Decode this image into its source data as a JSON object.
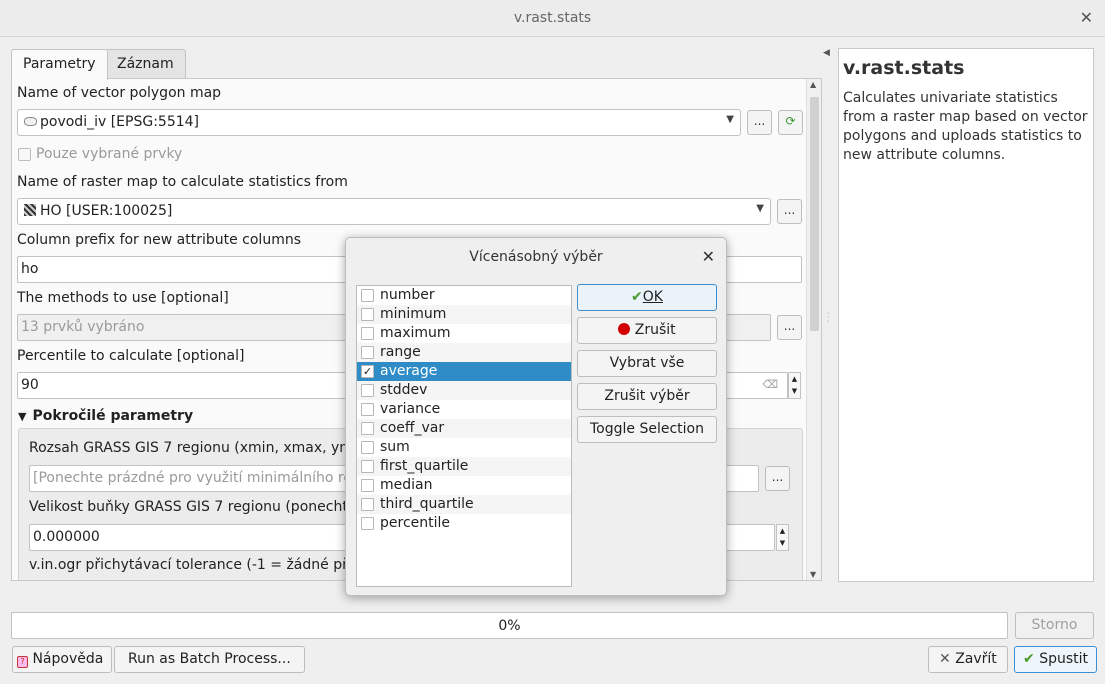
{
  "window": {
    "title": "v.rast.stats"
  },
  "tabs": [
    "Parametry",
    "Záznam"
  ],
  "form": {
    "vector_label": "Name of vector polygon map",
    "vector_value": "povodi_iv [EPSG:5514]",
    "only_selected_label": "Pouze vybrané prvky",
    "raster_label": "Name of raster map to calculate statistics from",
    "raster_value": "HO [USER:100025]",
    "prefix_label": "Column prefix for new attribute columns",
    "prefix_value": "ho",
    "methods_label": "The methods to use [optional]",
    "methods_value": "13 prvků vybráno",
    "percentile_label": "Percentile to calculate [optional]",
    "percentile_value": "90",
    "advanced_label": "Pokročilé parametry",
    "region_label": "Rozsah GRASS GIS 7 regionu (xmin, xmax, ymin",
    "region_placeholder": "[Ponechte prázdné pro využití minimálního rozs",
    "cellsize_label": "Velikost buňky GRASS GIS 7 regionu (ponechte",
    "cellsize_value": "0.000000",
    "snap_label": "v.in.ogr přichytávací tolerance (-1 = žádné přichy",
    "dots": "..."
  },
  "help": {
    "title": "v.rast.stats",
    "description": "Calculates univariate statistics from a raster map based on vector polygons and uploads statistics to new attribute columns."
  },
  "progress": {
    "percent": 0,
    "text": "0%"
  },
  "bottom": {
    "cancel": "Storno",
    "help": "Nápověda",
    "batch": "Run as Batch Process...",
    "close": "Zavřít",
    "run": "Spustit"
  },
  "modal": {
    "title": "Vícenásobný výběr",
    "items": [
      {
        "label": "number",
        "checked": false
      },
      {
        "label": "minimum",
        "checked": false
      },
      {
        "label": "maximum",
        "checked": false
      },
      {
        "label": "range",
        "checked": false
      },
      {
        "label": "average",
        "checked": true
      },
      {
        "label": "stddev",
        "checked": false
      },
      {
        "label": "variance",
        "checked": false
      },
      {
        "label": "coeff_var",
        "checked": false
      },
      {
        "label": "sum",
        "checked": false
      },
      {
        "label": "first_quartile",
        "checked": false
      },
      {
        "label": "median",
        "checked": false
      },
      {
        "label": "third_quartile",
        "checked": false
      },
      {
        "label": "percentile",
        "checked": false
      }
    ],
    "selected_index": 4,
    "ok": "OK",
    "cancel": "Zrušit",
    "select_all": "Vybrat vše",
    "clear_selection": "Zrušit výběr",
    "toggle": "Toggle Selection"
  },
  "colors": {
    "accent": "#308cc6"
  }
}
